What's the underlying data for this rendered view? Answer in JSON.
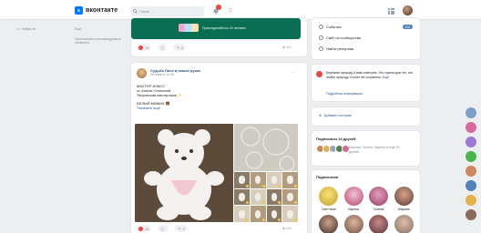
{
  "app": {
    "logo_letter": "к",
    "logo_text": "вконтакте"
  },
  "search": {
    "placeholder": "Поиск"
  },
  "left_nav": {
    "news_label": "Новости",
    "sublabel": "Ещё",
    "hint": "Приложения и рекомендуемые элементы"
  },
  "promo": {
    "text": "Присоединяйтесь 20 человек"
  },
  "top_post_actions": {
    "likes": "13",
    "reposts": "3",
    "views": "321"
  },
  "post": {
    "author": "Судьба Лиса в наших руках",
    "date": "18 июня в 14:40",
    "lines": [
      "МАСТЕР-КЛАСС",
      "от Алины Олониной",
      "Творческая мастерская"
    ],
    "subtitle": "БЕЛЫЙ МИШКА",
    "show_more": "Показать ещё",
    "likes": "28",
    "comments": "",
    "reposts": "2",
    "views": "423"
  },
  "right": {
    "events_label": "События",
    "events_count": "432",
    "communities_label": "Сайт из сообщества",
    "reports_label": "Найти репортаж",
    "info_text": "Берёжем природу и вам советуем. Это группа для тех, кто любит природу и хочет её сохранить.",
    "info_more": "Ещё",
    "info_link": "Подробная информация",
    "stories_label": "Добавить историю",
    "friends_title": "Подписаны 13 друзей",
    "friends_names": "Марина, Галина, Карина и ещё 15 друзей",
    "subs_title": "Подписчики",
    "subscribers": [
      {
        "name": "Светлана"
      },
      {
        "name": "Карина"
      },
      {
        "name": "Галина"
      },
      {
        "name": "Марина"
      },
      {
        "name": ""
      },
      {
        "name": ""
      },
      {
        "name": ""
      },
      {
        "name": ""
      }
    ]
  },
  "colors": {
    "accent": "#0077ff",
    "link": "#2a5885",
    "promo_bg": "#0a6f52",
    "like_red": "#e64646"
  }
}
